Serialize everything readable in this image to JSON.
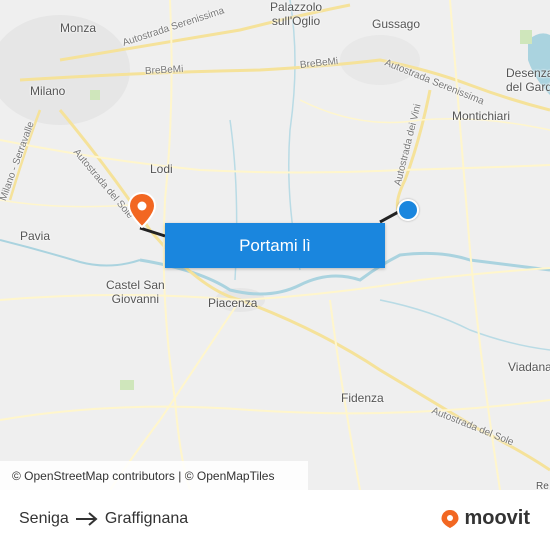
{
  "map": {
    "places": [
      {
        "name": "Palazzolo\nsull'Oglio",
        "id": "palazzolo"
      },
      {
        "name": "Gussago",
        "id": "gussago"
      },
      {
        "name": "Monza",
        "id": "monza"
      },
      {
        "name": "Milano",
        "id": "milano"
      },
      {
        "name": "Lodi",
        "id": "lodi"
      },
      {
        "name": "Pavia",
        "id": "pavia"
      },
      {
        "name": "Castel San\nGiovanni",
        "id": "castel"
      },
      {
        "name": "Piacenza",
        "id": "piacenza"
      },
      {
        "name": "Fidenza",
        "id": "fidenza"
      },
      {
        "name": "Montichiari",
        "id": "montichiari"
      },
      {
        "name": "Desenzano\ndel Garda",
        "id": "desenzano"
      },
      {
        "name": "Viadana",
        "id": "viadana"
      },
      {
        "name": "Re",
        "id": "re"
      }
    ],
    "roads": {
      "serenissima_west": "Autostrada Serenissima",
      "serenissima_east": "Autostrada Serenissima",
      "brebemi_west": "BreBeMi",
      "brebemi_east": "BreBeMi",
      "vini": "Autostrada dei Vini",
      "sole_west": "Autostrada del Sole",
      "sole_east": "Autostrada del Sole",
      "serravalle": "Milano - Serravalle"
    },
    "origin_color": "#1a86de",
    "destination_color": "#f26722"
  },
  "cta": {
    "label": "Portami lì"
  },
  "attribution": {
    "text": "© OpenStreetMap contributors | © OpenMapTiles"
  },
  "route": {
    "from": "Seniga",
    "to": "Graffignana"
  },
  "brand": {
    "name": "moovit"
  }
}
